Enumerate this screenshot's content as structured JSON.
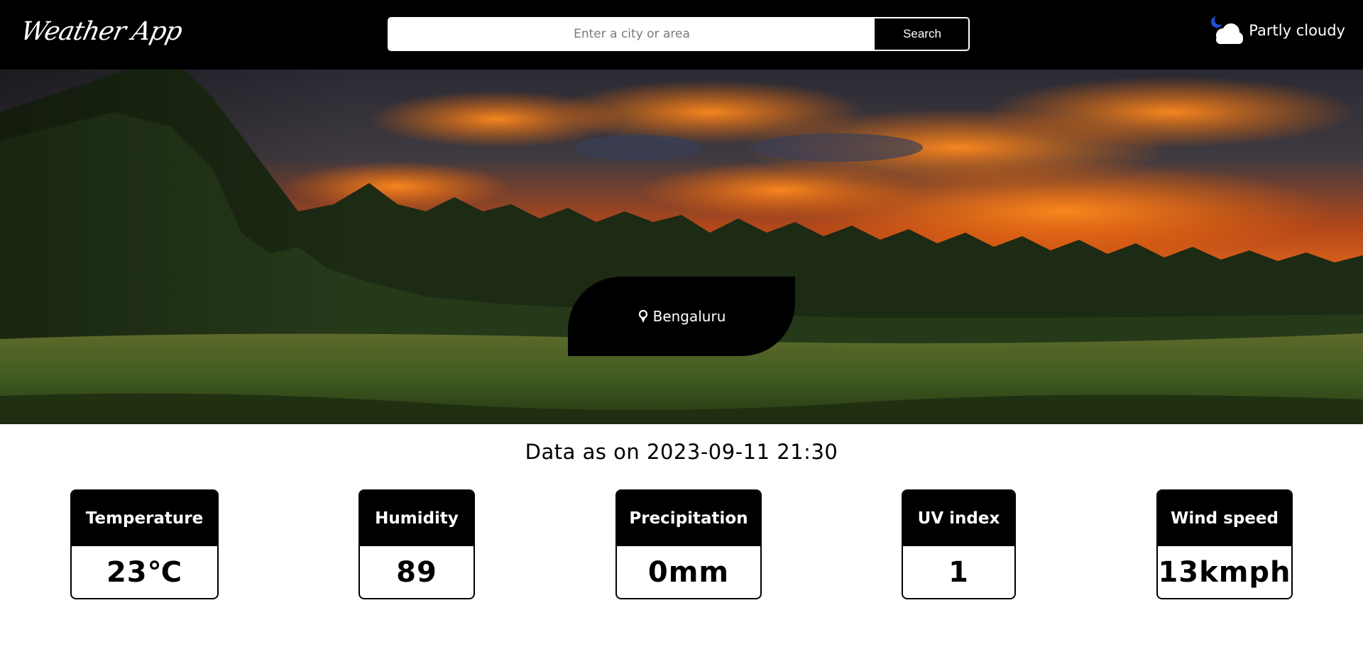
{
  "header": {
    "logo_text": "Weather App",
    "search": {
      "placeholder": "Enter a city or area",
      "value": "",
      "button_label": "Search"
    },
    "current_condition": {
      "icon": "partly-cloudy-night-icon",
      "text": "Partly cloudy"
    }
  },
  "hero": {
    "image": "sunset-forest-meadow-image",
    "location_icon": "map-pin-icon",
    "location": "Bengaluru"
  },
  "data_timestamp": "Data as on 2023-09-11 21:30",
  "metrics": [
    {
      "label": "Temperature",
      "value": "23℃"
    },
    {
      "label": "Humidity",
      "value": "89"
    },
    {
      "label": "Precipitation",
      "value": "0mm"
    },
    {
      "label": "UV index",
      "value": "1"
    },
    {
      "label": "Wind speed",
      "value": "13kmph"
    }
  ],
  "colors": {
    "primary": "#000000",
    "background": "#ffffff",
    "text_on_dark": "#ffffff"
  }
}
